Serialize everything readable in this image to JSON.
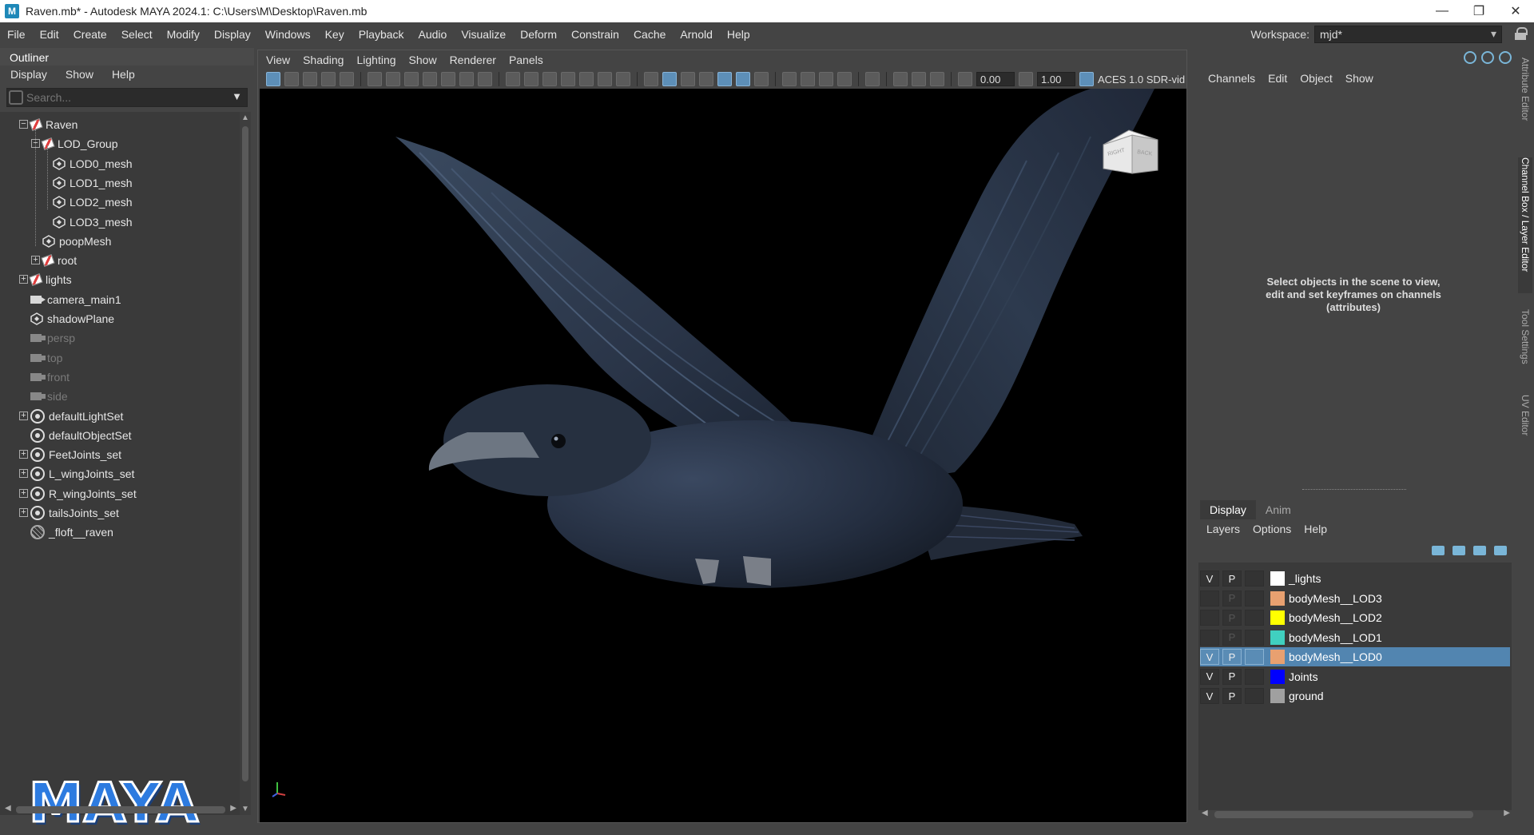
{
  "window": {
    "title": "Raven.mb* - Autodesk MAYA 2024.1: C:\\Users\\M\\Desktop\\Raven.mb"
  },
  "menubar": [
    "File",
    "Edit",
    "Create",
    "Select",
    "Modify",
    "Display",
    "Windows",
    "Key",
    "Playback",
    "Audio",
    "Visualize",
    "Deform",
    "Constrain",
    "Cache",
    "Arnold",
    "Help"
  ],
  "workspace": {
    "label": "Workspace:",
    "value": "mjd*"
  },
  "outliner": {
    "title": "Outliner",
    "menu": [
      "Display",
      "Show",
      "Help"
    ],
    "search_placeholder": "Search...",
    "items": [
      {
        "label": "Raven",
        "icon": "group-icon",
        "dim": false
      },
      {
        "label": "LOD_Group",
        "icon": "group-icon",
        "dim": false
      },
      {
        "label": "LOD0_mesh",
        "icon": "mesh-icon",
        "dim": false
      },
      {
        "label": "LOD1_mesh",
        "icon": "mesh-icon",
        "dim": false
      },
      {
        "label": "LOD2_mesh",
        "icon": "mesh-icon",
        "dim": false
      },
      {
        "label": "LOD3_mesh",
        "icon": "mesh-icon",
        "dim": false
      },
      {
        "label": "poopMesh",
        "icon": "mesh-icon",
        "dim": false
      },
      {
        "label": "root",
        "icon": "group-icon",
        "dim": false
      },
      {
        "label": "lights",
        "icon": "group-icon",
        "dim": false
      },
      {
        "label": "camera_main1",
        "icon": "camera-icon",
        "dim": false
      },
      {
        "label": "shadowPlane",
        "icon": "mesh-icon",
        "dim": false
      },
      {
        "label": "persp",
        "icon": "camera-icon",
        "dim": true
      },
      {
        "label": "top",
        "icon": "camera-icon",
        "dim": true
      },
      {
        "label": "front",
        "icon": "camera-icon",
        "dim": true
      },
      {
        "label": "side",
        "icon": "camera-icon",
        "dim": true
      },
      {
        "label": "defaultLightSet",
        "icon": "set-icon",
        "dim": false
      },
      {
        "label": "defaultObjectSet",
        "icon": "set-icon",
        "dim": false
      },
      {
        "label": "FeetJoints_set",
        "icon": "set-icon",
        "dim": false
      },
      {
        "label": "L_wingJoints_set",
        "icon": "set-icon",
        "dim": false
      },
      {
        "label": "R_wingJoints_set",
        "icon": "set-icon",
        "dim": false
      },
      {
        "label": "tailsJoints_set",
        "icon": "set-icon",
        "dim": false
      },
      {
        "label": "_floft__raven",
        "icon": "loft-icon",
        "dim": false
      }
    ],
    "logo_text": "MAYA"
  },
  "viewport": {
    "menu": [
      "View",
      "Shading",
      "Lighting",
      "Show",
      "Renderer",
      "Panels"
    ],
    "field_a": "0.00",
    "field_b": "1.00",
    "color_space": "ACES 1.0 SDR-vid",
    "viewcube_right": "RIGHT",
    "viewcube_back": "BACK"
  },
  "channel_box": {
    "menu": [
      "Channels",
      "Edit",
      "Object",
      "Show"
    ],
    "message": "Select objects in the scene to view, edit and set keyframes on channels (attributes)"
  },
  "layer_editor": {
    "tabs": [
      "Display",
      "Anim"
    ],
    "menu": [
      "Layers",
      "Options",
      "Help"
    ],
    "layers": [
      {
        "v": "V",
        "p": "P",
        "color": "#ffffff",
        "name": "_lights",
        "selected": false
      },
      {
        "v": "",
        "p": "P",
        "color": "#e8a070",
        "name": "bodyMesh__LOD3",
        "selected": false
      },
      {
        "v": "",
        "p": "P",
        "color": "#ffff00",
        "name": "bodyMesh__LOD2",
        "selected": false
      },
      {
        "v": "",
        "p": "P",
        "color": "#40d0c0",
        "name": "bodyMesh__LOD1",
        "selected": false
      },
      {
        "v": "V",
        "p": "P",
        "color": "#e8a070",
        "name": "bodyMesh__LOD0",
        "selected": true
      },
      {
        "v": "V",
        "p": "P",
        "color": "#0000ff",
        "name": "Joints",
        "selected": false
      },
      {
        "v": "V",
        "p": "P",
        "color": "#a0a0a0",
        "name": "ground",
        "selected": false
      }
    ]
  },
  "side_tabs": [
    "Attribute Editor",
    "Channel Box / Layer Editor",
    "Tool Settings",
    "UV Editor"
  ]
}
